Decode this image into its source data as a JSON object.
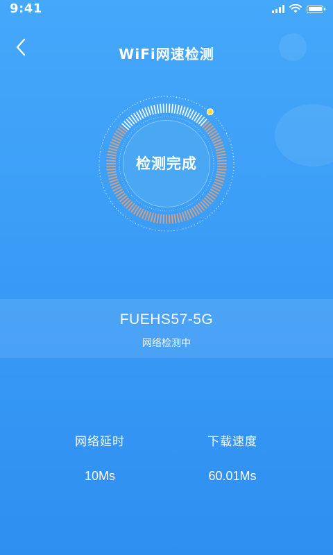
{
  "status_bar": {
    "time": "9:41",
    "icons": [
      "signal-icon",
      "wifi-icon",
      "battery-icon"
    ],
    "battery_level": 1.0
  },
  "header": {
    "title": "WiFi网速检测",
    "back_icon": "chevron-left-icon"
  },
  "gauge": {
    "label": "检测完成",
    "progress": 0.15,
    "colors": {
      "tick_done": "#f0a06a",
      "tick_pending": "#ffffff",
      "indicator": "#ffe04a",
      "core": "#4aa7f4"
    }
  },
  "network": {
    "ssid": "FUEHS57-5G",
    "status": "网络检测中"
  },
  "stats": {
    "latency": {
      "label": "网络延时",
      "value": "10Ms"
    },
    "download": {
      "label": "下载速度",
      "value": "60.01Ms"
    }
  },
  "colors": {
    "background_top": "#45a8fa",
    "background_bottom": "#2f8ff1",
    "text": "#ffffff"
  }
}
